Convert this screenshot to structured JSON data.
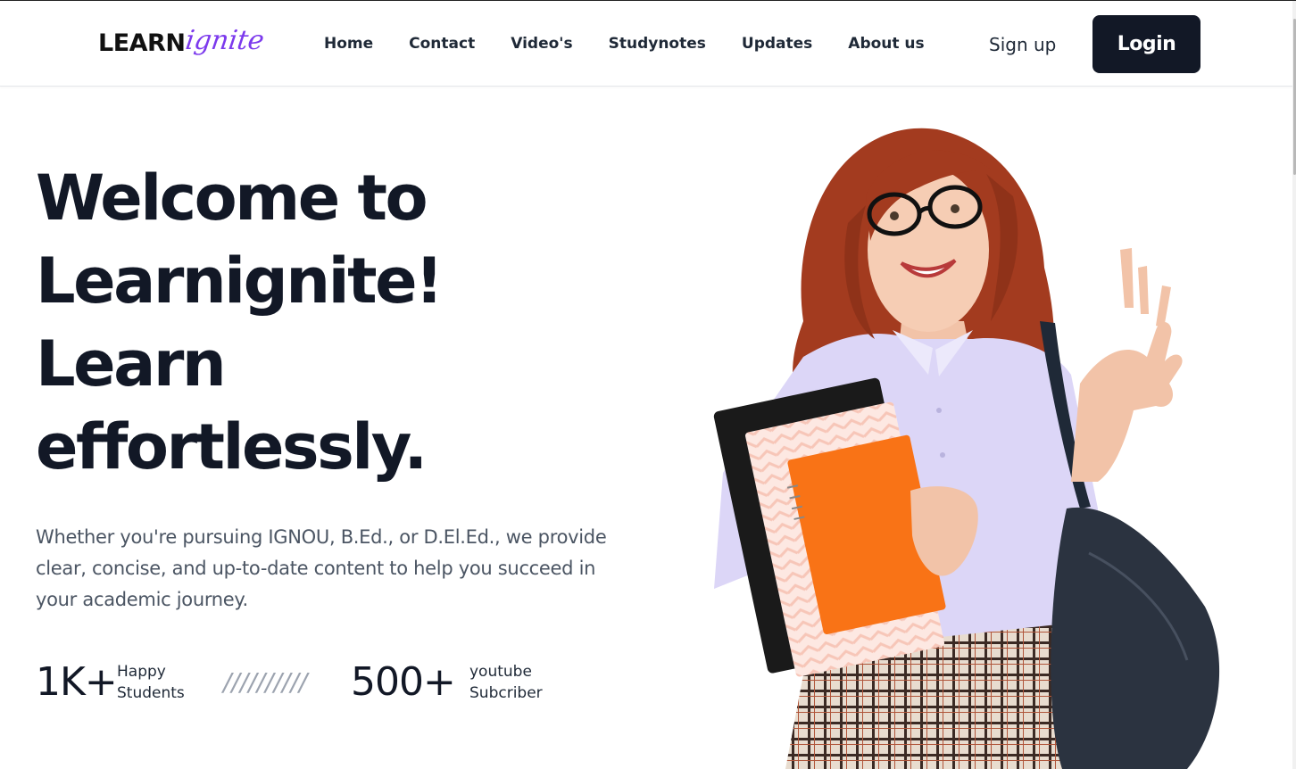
{
  "header": {
    "logo": {
      "main": "LEARN",
      "script": "ignite",
      "script_color": "#7c3aed"
    },
    "nav": [
      {
        "label": "Home"
      },
      {
        "label": "Contact"
      },
      {
        "label": "Video's"
      },
      {
        "label": "Studynotes"
      },
      {
        "label": "Updates"
      },
      {
        "label": "About us"
      }
    ],
    "signup_label": "Sign up",
    "login_label": "Login",
    "login_color": "#121826"
  },
  "hero": {
    "title_lines": [
      "Welcome to",
      "Learnignite!",
      "Learn",
      "effortlessly."
    ],
    "description": "Whether you're pursuing IGNOU, B.Ed., or D.El.Ed., we provide clear, concise, and up-to-date content to help you succeed in your academic journey.",
    "stats": [
      {
        "value": "1K+",
        "label_line1": "Happy",
        "label_line2": "Students"
      },
      {
        "value": "500+",
        "label_line1": "youtube",
        "label_line2": "Subcriber"
      }
    ],
    "separator": "//////////",
    "image": {
      "subject": "smiling-student-with-notebooks-and-backpack",
      "hair_color": "#a33b1f",
      "shirt_color": "#dcd6f7",
      "notebook_color": "#f97316"
    }
  }
}
